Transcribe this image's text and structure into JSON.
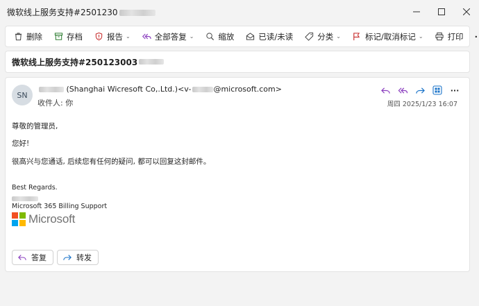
{
  "window": {
    "title": "微软线上服务支持#2501230",
    "controls": [
      "minimize",
      "maximize",
      "close"
    ]
  },
  "toolbar": {
    "delete": "删除",
    "archive": "存档",
    "report": "报告",
    "reply_all": "全部答复",
    "zoom": "缩放",
    "read_unread": "已读/未读",
    "categorize": "分类",
    "flag": "标记/取消标记",
    "print": "打印",
    "more": "···"
  },
  "subject": {
    "text": "微软线上服务支持#250123003"
  },
  "message": {
    "avatar_initials": "SN",
    "sender_company": "(Shanghai Wicresoft Co,.Ltd.)",
    "sender_email_prefix": "<v-",
    "sender_email_suffix": "@microsoft.com>",
    "recipients_label": "收件人:",
    "recipients_value": "你",
    "datetime": "周四 2025/1/23 16:07",
    "body": {
      "greeting": "尊敬的管理员,",
      "hello": "您好!",
      "content": "很高兴与您通话, 后续您有任何的疑问, 都可以回复这封邮件。",
      "regards": "Best Regards.",
      "team": "Microsoft 365 Billing Support",
      "logo_text": "Microsoft"
    }
  },
  "footer_buttons": {
    "reply": "答复",
    "forward": "转发"
  },
  "colors": {
    "reply_purple": "#8b3fbf",
    "forward_blue": "#1a73c9",
    "ms_red": "#f25022",
    "ms_green": "#7fba00",
    "ms_blue": "#00a4ef",
    "ms_yellow": "#ffb900"
  },
  "icons": {
    "delete": "trash-icon",
    "archive": "archive-icon",
    "report": "shield-icon",
    "reply_all": "reply-all-icon",
    "zoom": "zoom-icon",
    "read_unread": "envelope-open-icon",
    "categorize": "tag-icon",
    "flag": "flag-icon",
    "print": "printer-icon"
  }
}
